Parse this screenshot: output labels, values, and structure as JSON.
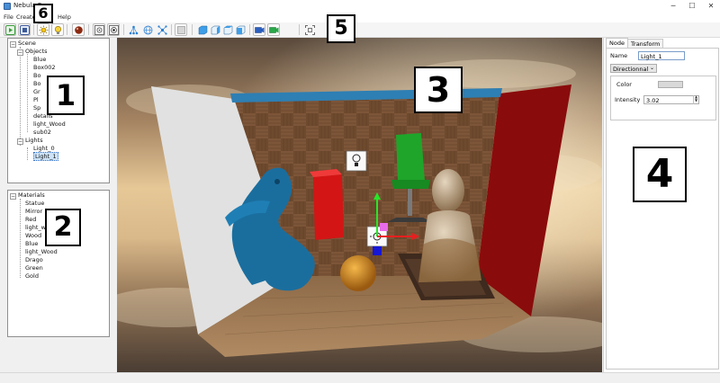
{
  "window": {
    "title": "Nebula R",
    "controls": {
      "minimize": "─",
      "maximize": "☐",
      "close": "✕"
    }
  },
  "menu": {
    "file": "File",
    "create": "Create",
    "help": "Help"
  },
  "callouts": {
    "c1": "1",
    "c2": "2",
    "c3": "3",
    "c4": "4",
    "c5": "5",
    "c6": "6"
  },
  "toolbar": {
    "buttons": [
      "play-icon",
      "stop-icon",
      "sun-icon",
      "bulb-icon",
      "sphere-icon",
      "render-region-icon",
      "render-full-icon",
      "tree-icon",
      "globe-icon",
      "network-icon",
      "cube-empty-icon",
      "view-front-icon",
      "view-side-icon",
      "view-top-icon",
      "view-persp-icon",
      "camera-icon",
      "camera-green-icon",
      "frame-select-icon"
    ]
  },
  "scene_tree": {
    "root": "Scene",
    "objects_label": "Objects",
    "objects": [
      "Blue",
      "Box002",
      "Bo",
      "Bo",
      "Gr",
      "Pl",
      "Sp",
      "details",
      "light_Wood",
      "sub02"
    ],
    "lights_label": "Lights",
    "lights": [
      "Light_0",
      "Light_1"
    ],
    "selected": "Light_1"
  },
  "materials_tree": {
    "root": "Materials",
    "items": [
      "Statue",
      "Mirror",
      "Red",
      "light_wo",
      "Wood",
      "Blue",
      "light_Wood",
      "Drago",
      "Green",
      "Gold"
    ]
  },
  "properties": {
    "tabs": [
      "Node",
      "Transform"
    ],
    "active_tab": "Node",
    "name_label": "Name",
    "name_value": "Light_1",
    "light_type": "Directionnal",
    "color_label": "Color",
    "intensity_label": "Intensity",
    "intensity_value": "3.02"
  },
  "colors": {
    "accent_selection": "#cde3f7",
    "chair": "#1fa52a",
    "dragon": "#1a6e9e",
    "red_box": "#d41515"
  }
}
